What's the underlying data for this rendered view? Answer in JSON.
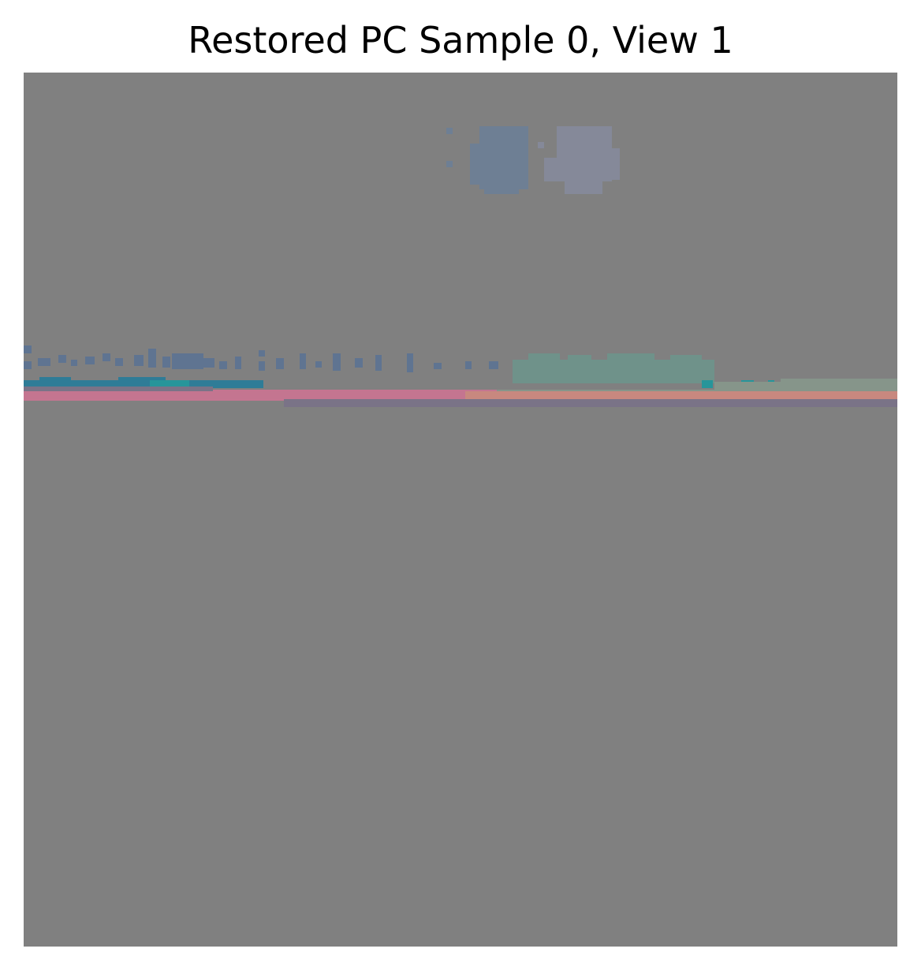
{
  "figure": {
    "title": "Restored PC Sample 0, View 1"
  },
  "image": {
    "background_color": "#808080",
    "palette": {
      "slate_blue": "#6e7f94",
      "lavender_gray": "#858999",
      "steel_blue": "#5f7491",
      "deep_teal": "#2f7c97",
      "bright_teal": "#27959a",
      "sea_green": "#6f928a",
      "sage_green": "#86958a",
      "rose_pink": "#c47590",
      "salmon": "#c8887f",
      "mauve": "#7a7387"
    }
  }
}
